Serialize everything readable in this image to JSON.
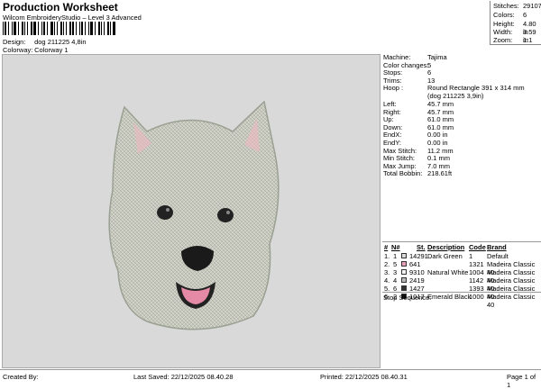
{
  "header": {
    "title": "Production Worksheet",
    "subtitle": "Wilcom EmbroideryStudio – Level 3 Advanced",
    "design_label": "Design:",
    "design_value": "dog 211225 4,8in",
    "colorway_label": "Colorway:",
    "colorway_value": "Colorway 1"
  },
  "stats": [
    {
      "label": "Stitches:",
      "value": "29107"
    },
    {
      "label": "Colors:",
      "value": "6"
    },
    {
      "label": "Height:",
      "value": "4.80 in"
    },
    {
      "label": "Width:",
      "value": "3.59 in"
    },
    {
      "label": "Zoom:",
      "value": "1:1"
    }
  ],
  "properties": [
    {
      "label": "Machine:",
      "value": "Tajima"
    },
    {
      "label": "Color changes:",
      "value": "5"
    },
    {
      "label": "Stops:",
      "value": "6"
    },
    {
      "label": "Trims:",
      "value": "13"
    },
    {
      "label": "Hoop :",
      "value": "Round Rectangle 391 x 314 mm (dog 211225 3,9in)"
    },
    {
      "label": "Left:",
      "value": "45.7 mm"
    },
    {
      "label": "Right:",
      "value": "45.7 mm"
    },
    {
      "label": "Up:",
      "value": "61.0 mm"
    },
    {
      "label": "Down:",
      "value": "61.0 mm"
    },
    {
      "label": "EndX:",
      "value": "0.00 in"
    },
    {
      "label": "EndY:",
      "value": "0.00 in"
    },
    {
      "label": "Max Stitch:",
      "value": "11.2 mm"
    },
    {
      "label": "Min Stitch:",
      "value": "0.1 mm"
    },
    {
      "label": "Max Jump:",
      "value": "7.0 mm"
    },
    {
      "label": "Total Bobbin:",
      "value": "218.61ft"
    }
  ],
  "color_table": {
    "headers": {
      "num": "#",
      "n": "N#",
      "st": "St.",
      "desc": "Description",
      "code": "Code",
      "brand": "Brand"
    },
    "rows": [
      {
        "num": "1.",
        "n": "1",
        "color": "#d9d9d9",
        "st": "14291",
        "desc": "Dark Green",
        "code": "1",
        "brand": "Default"
      },
      {
        "num": "2.",
        "n": "5",
        "color": "#e8a0b8",
        "st": "641",
        "desc": "",
        "code": "1321",
        "brand": "Madeira Classic 40"
      },
      {
        "num": "3.",
        "n": "3",
        "color": "#f4f4f0",
        "st": "9310",
        "desc": "Natural White",
        "code": "1004",
        "brand": "Madeira Classic 40"
      },
      {
        "num": "4.",
        "n": "4",
        "color": "#b8b8b8",
        "st": "2419",
        "desc": "",
        "code": "1142",
        "brand": "Madeira Classic 40"
      },
      {
        "num": "5.",
        "n": "6",
        "color": "#333333",
        "st": "1427",
        "desc": "",
        "code": "1393",
        "brand": "Madeira Classic 40"
      },
      {
        "num": "6.",
        "n": "2",
        "color": "#111111",
        "st": "1017",
        "desc": "Emerald Black",
        "code": "1000",
        "brand": "Madeira Classic 40"
      }
    ]
  },
  "stop_sequence_label": "Stop Sequence:",
  "footer": {
    "created_by": "Created By:",
    "last_saved": "Last Saved: 22/12/2025 08.40.28",
    "printed": "Printed: 22/12/2025 08.40.31",
    "page": "Page 1 of 1"
  },
  "colors": {
    "canvas_bg": "#d9d9d9",
    "fur": "#c9cbc0",
    "ear_inner": "#e8b9c0",
    "tongue": "#e58aa6"
  },
  "icons": [
    "barcode-icon",
    "swatch-icon"
  ]
}
